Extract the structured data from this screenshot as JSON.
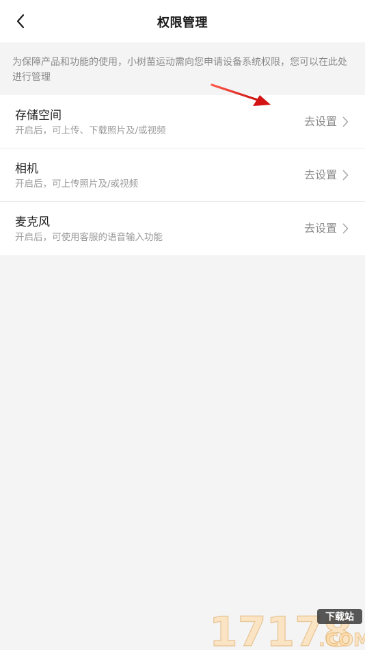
{
  "header": {
    "back_icon": "chevron-left-icon",
    "title": "权限管理"
  },
  "notice": {
    "text": "为保障产品和功能的使用，小树苗运动需向您申请设备系统权限，您可以在此处进行管理"
  },
  "permissions": [
    {
      "title": "存储空间",
      "description": "开启后，可上传、下载照片及/或视频",
      "action_label": "去设置",
      "action_icon": "chevron-right-icon"
    },
    {
      "title": "相机",
      "description": "开启后，可上传照片及/或视频",
      "action_label": "去设置",
      "action_icon": "chevron-right-icon"
    },
    {
      "title": "麦克风",
      "description": "开启后，可使用客服的语音输入功能",
      "action_label": "去设置",
      "action_icon": "chevron-right-icon"
    }
  ],
  "annotation": {
    "arrow_color": "#e02020"
  },
  "watermark": {
    "number": "17178",
    "badge": "下载站",
    "domain": ".COM"
  }
}
